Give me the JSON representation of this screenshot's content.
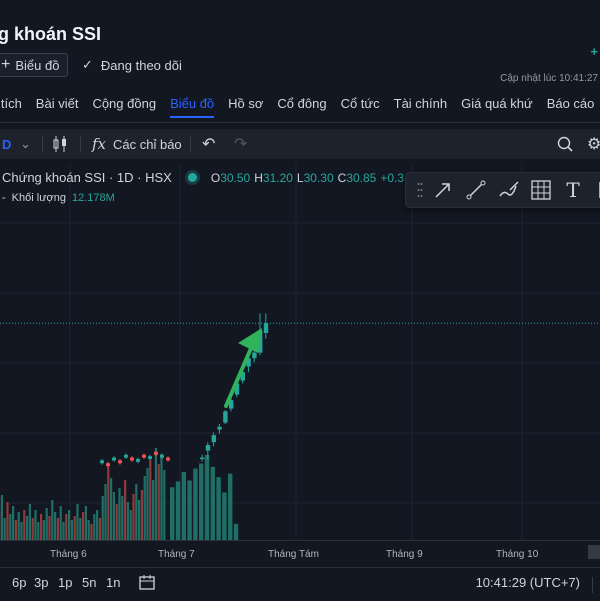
{
  "header": {
    "title": "g khoán SSI",
    "chart_button": "Biểu đồ",
    "follow_button": "Đang theo dõi",
    "update_text": "Cập nhật lúc  10:41:27",
    "plus_indicator": "+"
  },
  "tabs": [
    {
      "label": "n tích",
      "active": false
    },
    {
      "label": "Bài viết",
      "active": false
    },
    {
      "label": "Cộng đồng",
      "active": false
    },
    {
      "label": "Biểu đồ",
      "active": true
    },
    {
      "label": "Hồ sơ",
      "active": false
    },
    {
      "label": "Cổ đông",
      "active": false
    },
    {
      "label": "Cổ tức",
      "active": false
    },
    {
      "label": "Tài chính",
      "active": false
    },
    {
      "label": "Giá quá khứ",
      "active": false
    },
    {
      "label": "Báo cáo",
      "active": false
    }
  ],
  "toolbar": {
    "interval": "D",
    "indicators_label": "Các chỉ báo",
    "fx_symbol": "fx"
  },
  "legend": {
    "symbol": "Chứng khoán SSI · 1D · HSX",
    "ohlc": [
      {
        "k": "O",
        "v": "30.50"
      },
      {
        "k": "H",
        "v": "31.20"
      },
      {
        "k": "L",
        "v": "30.30"
      },
      {
        "k": "C",
        "v": "30.85"
      },
      {
        "k": "",
        "v": "+0.3"
      }
    ],
    "volume_label": "Khối lượng",
    "volume_value": "12.178M"
  },
  "xaxis": [
    "Tháng 6",
    "Tháng 7",
    "Tháng Tám",
    "Tháng 9",
    "Tháng 10"
  ],
  "bottom": {
    "ranges": [
      "6p",
      "3p",
      "1p",
      "5n",
      "1n"
    ],
    "clock": "10:41:29 (UTC+7)"
  },
  "colors": {
    "up": "#26a69a",
    "down": "#ef5350",
    "accent": "#2962ff",
    "arrow": "#2fb35b",
    "background": "#131722"
  },
  "chart_data": {
    "type": "candlestick",
    "up_color": "#26a69a",
    "down_color": "#ef5350",
    "price_line": 30.85,
    "annotations": [
      "green-arrow-up"
    ],
    "candles": [
      {
        "o": 26.0,
        "h": 26.15,
        "l": 25.9,
        "c": 26.05,
        "vol": 0.62
      },
      {
        "o": 26.3,
        "h": 26.6,
        "l": 26.0,
        "c": 26.5,
        "vol": 0.69
      },
      {
        "o": 26.6,
        "h": 26.95,
        "l": 26.45,
        "c": 26.85,
        "vol": 0.8
      },
      {
        "o": 27.05,
        "h": 27.25,
        "l": 26.9,
        "c": 27.15,
        "vol": 0.7
      },
      {
        "o": 27.3,
        "h": 27.75,
        "l": 27.25,
        "c": 27.7,
        "vol": 0.84
      },
      {
        "o": 27.8,
        "h": 28.2,
        "l": 27.7,
        "c": 28.1,
        "vol": 0.9
      },
      {
        "o": 28.3,
        "h": 28.8,
        "l": 28.2,
        "c": 28.7,
        "vol": 1.0
      },
      {
        "o": 28.8,
        "h": 29.2,
        "l": 28.7,
        "c": 29.1,
        "vol": 0.86
      },
      {
        "o": 29.3,
        "h": 29.7,
        "l": 29.1,
        "c": 29.6,
        "vol": 0.74
      },
      {
        "o": 29.6,
        "h": 29.9,
        "l": 29.45,
        "c": 29.8,
        "vol": 0.56
      },
      {
        "o": 29.8,
        "h": 31.2,
        "l": 29.7,
        "c": 30.6,
        "vol": 0.78
      },
      {
        "o": 30.5,
        "h": 31.2,
        "l": 30.3,
        "c": 30.85,
        "vol": 0.19
      }
    ],
    "x_ticks": [
      "Tháng 6",
      "Tháng 7",
      "Tháng Tám",
      "Tháng 9",
      "Tháng 10"
    ]
  }
}
